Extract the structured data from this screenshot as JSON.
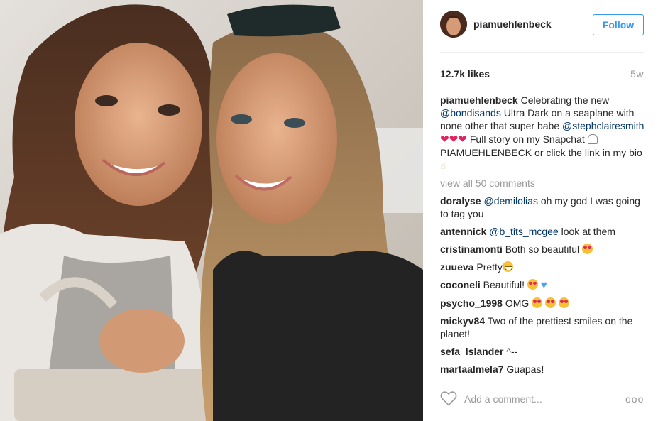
{
  "post": {
    "photo_alt": "Selfie of two smiling women seated on a seaplane",
    "header": {
      "username": "piamuehlenbeck",
      "follow_label": "Follow"
    },
    "likes": "12.7k likes",
    "time_ago": "5w",
    "caption": {
      "user": "piamuehlenbeck",
      "text_1": " Celebrating the new ",
      "mention_1": "@bondisands",
      "text_2": " Ultra Dark on a seaplane with none other that super babe ",
      "mention_2": "@stephclairesmith",
      "hearts": " ❤❤❤ ",
      "text_3": "Full story on my Snapchat ",
      "text_4": " PIAMUEHLENBECK or click the link in my bio "
    },
    "view_all_label": "view all 50 comments",
    "comments": [
      {
        "user": "doralyse",
        "mention": "@demilolias",
        "text": " oh my god I was going to tag you"
      },
      {
        "user": "antennick",
        "mention": "@b_tits_mcgee",
        "text": " look at them"
      },
      {
        "user": "cristinamonti",
        "text": " Both so beautiful "
      },
      {
        "user": "zuueva",
        "text": " Pretty"
      },
      {
        "user": "coconeli",
        "text": " Beautiful! "
      },
      {
        "user": "psycho_1998",
        "text": " OMG "
      },
      {
        "user": "mickyv84",
        "text": " Two of the prettiest smiles on the planet!"
      },
      {
        "user": "sefa_lslander",
        "text": " ^--"
      },
      {
        "user": "martaalmela7",
        "text": " Guapas!"
      }
    ],
    "footer": {
      "comment_placeholder": "Add a comment...",
      "more_label": "ooo"
    }
  },
  "icons": {
    "like": "heart-outline-icon",
    "more": "more-options-icon",
    "avatar": "avatar"
  },
  "colors": {
    "accent": "#3897f0",
    "mention": "#003569",
    "muted": "#999999"
  }
}
